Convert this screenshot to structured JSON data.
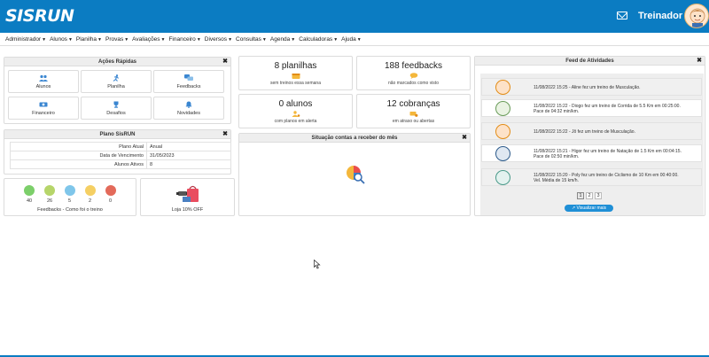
{
  "header": {
    "logo": "SISRUN",
    "user_name": "Treinador",
    "colors": {
      "brand": "#0b7cc2",
      "accent": "#1f8fd6"
    }
  },
  "menu": {
    "items": [
      "Administrador",
      "Alunos",
      "Planilha",
      "Provas",
      "Avaliações",
      "Financeiro",
      "Diversos",
      "Consultas",
      "Agenda",
      "Calculadoras",
      "Ajuda"
    ]
  },
  "quick_actions": {
    "title": "Ações Rápidas",
    "close": "✖",
    "items": [
      {
        "label": "Alunos",
        "icon": "users-icon"
      },
      {
        "label": "Planilha",
        "icon": "runner-icon"
      },
      {
        "label": "Feedbacks",
        "icon": "chat-icon"
      },
      {
        "label": "Financeiro",
        "icon": "money-icon"
      },
      {
        "label": "Desafios",
        "icon": "trophy-icon"
      },
      {
        "label": "Novidades",
        "icon": "bell-icon"
      }
    ]
  },
  "plan": {
    "title": "Plano SisRUN",
    "close": "✖",
    "rows": [
      {
        "key": "Plano Atual",
        "value": "Anual"
      },
      {
        "key": "Data de Vencimento",
        "value": "31/05/2023"
      },
      {
        "key": "Alunos Ativos",
        "value": "8"
      }
    ]
  },
  "feedback_mood": {
    "counts": [
      "40",
      "26",
      "5",
      "2",
      "0"
    ],
    "colors": [
      "#7ccf6a",
      "#b6d56a",
      "#7fc6ea",
      "#f5cf63",
      "#e36a5a"
    ],
    "caption": "Feedbacks - Como foi o treino"
  },
  "store": {
    "caption": "Loja 10% OFF"
  },
  "stats": [
    {
      "big": "8 planilhas",
      "sub": "sem treinos essa semana"
    },
    {
      "big": "188 feedbacks",
      "sub": "não marcados como visto"
    },
    {
      "big": "0 alunos",
      "sub": "com planos em alerta"
    },
    {
      "big": "12 cobranças",
      "sub": "em atraso ou abertas"
    }
  ],
  "accounts": {
    "title": "Situação contas a receber do mês",
    "close": "✖"
  },
  "feed": {
    "title": "Feed de Atividades",
    "close": "✖",
    "items": [
      {
        "line1": "11/08/2022 15:25 - Aline fez um treino de Musculação.",
        "line2": ""
      },
      {
        "line1": "11/08/2022 15:22 - Diogo fez um treino de Corrida de 5.5 Km em 00:25:00.",
        "line2": "Pace de 04:32 min/km."
      },
      {
        "line1": "11/08/2022 15:22 - Jô fez um treino de Musculação.",
        "line2": ""
      },
      {
        "line1": "11/08/2022 15:21 - Higor fez um treino de Natação de 1.5 Km em 00:04:15.",
        "line2": "Pace de 02:50 min/km."
      },
      {
        "line1": "11/08/2022 15:20 - Poly fez um treino de Ciclismo de 10 Km em 00:40:00.",
        "line2": "Vel. Média de 15 km/h."
      }
    ],
    "pages": [
      "1",
      "2",
      "3"
    ],
    "more_label": "Visualizar mais"
  }
}
